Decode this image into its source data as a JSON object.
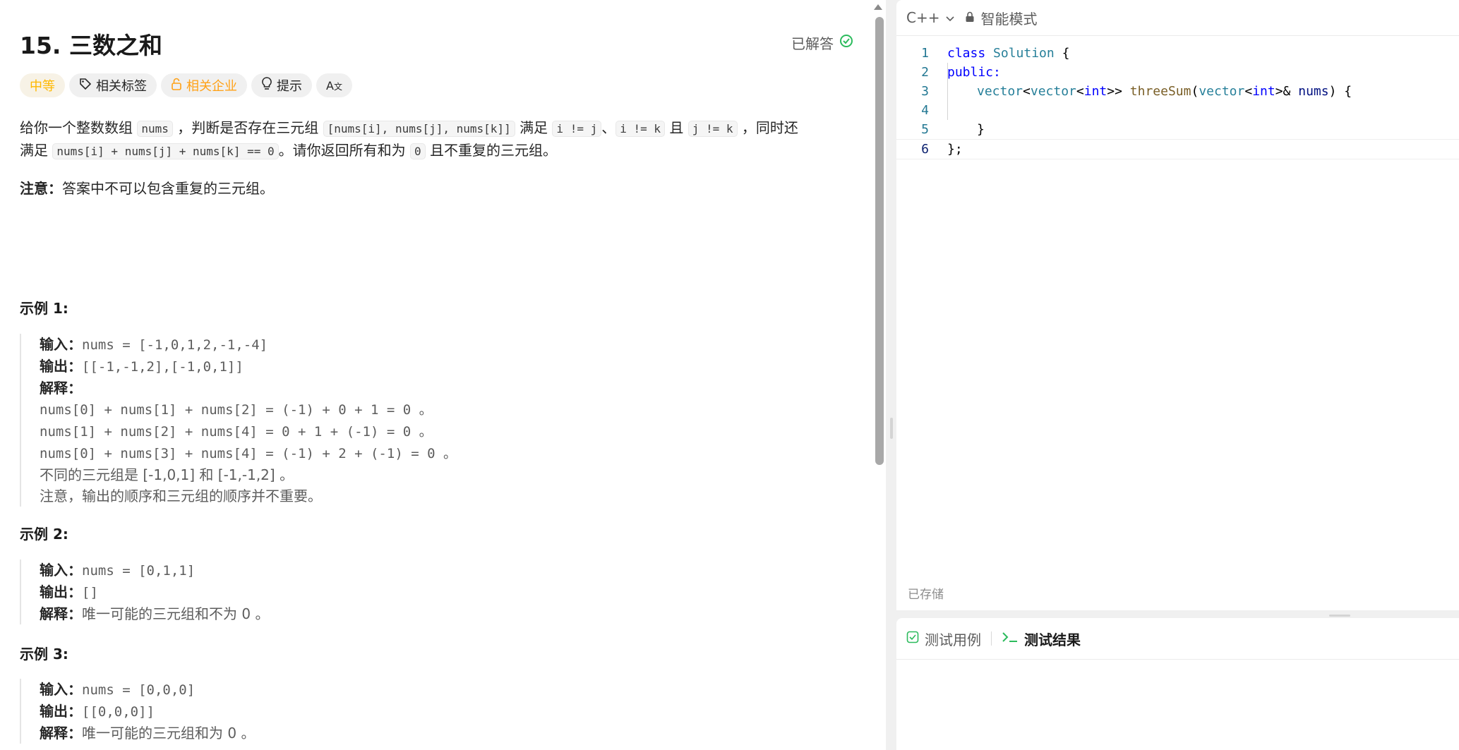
{
  "problem": {
    "title": "15. 三数之和",
    "status": "已解答",
    "tags": {
      "difficulty": "中等",
      "related_tags": "相关标签",
      "related_companies": "相关企业",
      "hint": "提示",
      "translate": "A文"
    },
    "desc": {
      "p1": "给你一个整数数组",
      "c1": "nums",
      "p2": "，判断是否存在三元组",
      "c2": "[nums[i], nums[j], nums[k]]",
      "p3": "满足",
      "c3": "i != j",
      "p4": "、",
      "c4": "i != k",
      "p5": "且",
      "c5": "j != k",
      "p6": "，同时还",
      "p7": "满足",
      "c6": "nums[i] + nums[j] + nums[k] == 0",
      "p8": "。请你返回所有和为",
      "c7": "0",
      "p9": "且不重复的三元组。"
    },
    "note_label": "注意：",
    "note_text": "答案中不可以包含重复的三元组。",
    "examples": [
      {
        "heading": "示例 1:",
        "input_label": "输入：",
        "input": "nums = [-1,0,1,2,-1,-4]",
        "output_label": "输出：",
        "output": "[[-1,-1,2],[-1,0,1]]",
        "explain_label": "解释：",
        "lines": [
          "nums[0] + nums[1] + nums[2] = (-1) + 0 + 1 = 0 。",
          "nums[1] + nums[2] + nums[4] = 0 + 1 + (-1) = 0 。",
          "nums[0] + nums[3] + nums[4] = (-1) + 2 + (-1) = 0 。",
          "不同的三元组是 [-1,0,1] 和 [-1,-1,2] 。",
          "注意，输出的顺序和三元组的顺序并不重要。"
        ]
      },
      {
        "heading": "示例 2:",
        "input_label": "输入：",
        "input": "nums = [0,1,1]",
        "output_label": "输出：",
        "output": "[]",
        "explain_label": "解释：",
        "explain": "唯一可能的三元组和不为 0 。"
      },
      {
        "heading": "示例 3:",
        "input_label": "输入：",
        "input": "nums = [0,0,0]",
        "output_label": "输出：",
        "output": "[[0,0,0]]",
        "explain_label": "解释：",
        "explain": "唯一可能的三元组和为 0 。"
      }
    ]
  },
  "editor": {
    "language": "C++",
    "mode": "智能模式",
    "saved_status": "已存储",
    "line_numbers": [
      "1",
      "2",
      "3",
      "4",
      "5",
      "6"
    ],
    "code": {
      "l1_kw": "class",
      "l1_name": "Solution",
      "l1_rest": " {",
      "l2": "public:",
      "l3_t1": "vector",
      "l3_p1": "<",
      "l3_t2": "vector",
      "l3_p2": "<",
      "l3_k1": "int",
      "l3_p3": ">> ",
      "l3_fn": "threeSum",
      "l3_p4": "(",
      "l3_t3": "vector",
      "l3_p5": "<",
      "l3_k2": "int",
      "l3_p6": ">& ",
      "l3_param": "nums",
      "l3_p7": ") {",
      "l5": "}",
      "l6": "};"
    }
  },
  "bottom_panel": {
    "tab_testcase": "测试用例",
    "tab_result": "测试结果"
  },
  "colors": {
    "accent_green": "#2cbb5d",
    "difficulty_yellow": "#ffb800",
    "company_orange": "#ffa116"
  }
}
